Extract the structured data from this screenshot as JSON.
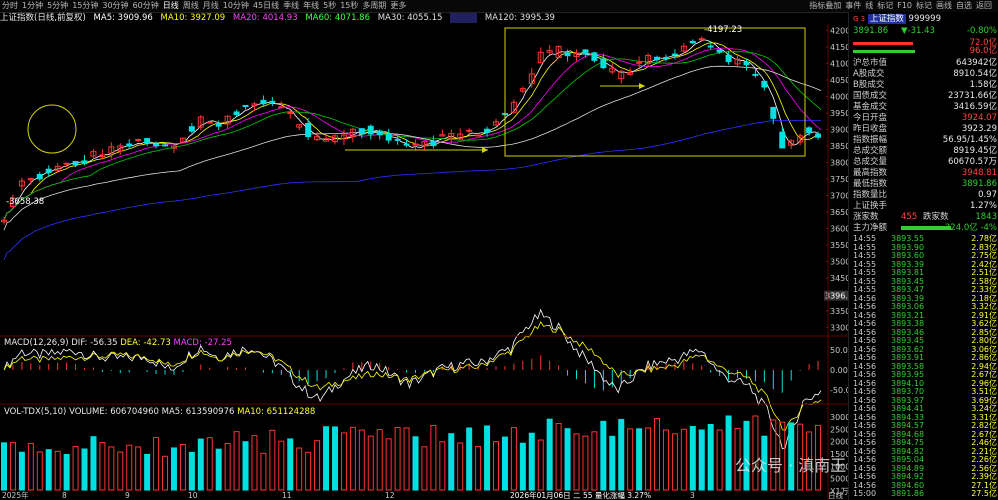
{
  "toolbar": {
    "items": [
      "分时",
      "1分钟",
      "5分钟",
      "15分钟",
      "30分钟",
      "60分钟",
      "日线",
      "周线",
      "月线",
      "10分钟",
      "45日线",
      "季线",
      "年线",
      "5秒",
      "15秒",
      "多周期",
      "更多"
    ],
    "active_index": 6,
    "right_items": [
      "指标叠加",
      "事件",
      "线",
      "标记",
      "F10",
      "标记",
      "画线",
      "自选",
      "返回"
    ]
  },
  "ma_line": {
    "title": "上证指数(日线,前复权)",
    "ma5": "MA5: 3909.96",
    "ma10": "MA10: 3927.09",
    "ma20": "MA20: 4014.93",
    "ma60": "MA60: 4071.86",
    "ma30": "MA30: 4055.15",
    "ma120": "MA120: 3995.39"
  },
  "price_axis": {
    "ticks": [
      "4200",
      "4150",
      "4100",
      "4050",
      "4000",
      "3950",
      "3900",
      "3850",
      "3800",
      "3750",
      "3700",
      "3650",
      "3600",
      "3550",
      "3500",
      "3450",
      "3400",
      "3350",
      "3300"
    ],
    "marker": "3396.3",
    "high_label": "4197.23",
    "low_label": "3658.38"
  },
  "macd": {
    "header": "MACD(12,26,9)",
    "dif": "DIF: -56.35",
    "dea": "DEA: -42.73",
    "macd": "MACD: -27.25",
    "ticks": [
      "50.00",
      "0.00",
      "-50.00"
    ]
  },
  "volume": {
    "header": "VOL-TDX(5,10)",
    "volume": "VOLUME: 606704960",
    "ma5": "MA5: 613590976",
    "ma10": "MA10: 651124288",
    "ticks": [
      "30000",
      "25000",
      "20000",
      "15000",
      "10000",
      "5000",
      "X1万"
    ]
  },
  "x_axis": {
    "labels": [
      "2025年",
      "8",
      "9",
      "10",
      "11",
      "12",
      "2026年01月06日 二 55 量化涨幅 3.27%",
      "2",
      "3",
      "日线"
    ]
  },
  "right_panel": {
    "index_name": "上证指数",
    "index_code": "999999",
    "price": "3891.86",
    "change": "▼-31.43",
    "change_pct": "-0.80%",
    "bar_values": [
      "72.0亿",
      "96.0亿"
    ],
    "stats": [
      {
        "k": "沪总市值",
        "v": "643942亿"
      },
      {
        "k": "A股成交",
        "v": "8910.54亿"
      },
      {
        "k": "B股成交",
        "v": "1.58亿"
      },
      {
        "k": "国债成交",
        "v": "23731.66亿"
      },
      {
        "k": "基金成交",
        "v": "3416.59亿"
      },
      {
        "k": "今日开盘",
        "v": "3924.07"
      },
      {
        "k": "昨日收盘",
        "v": "3923.29"
      },
      {
        "k": "指数振幅",
        "v": "56.95/1.45%"
      },
      {
        "k": "总成交额",
        "v": "8919.45亿"
      },
      {
        "k": "总成交量",
        "v": "60670.57万"
      },
      {
        "k": "最高指数",
        "v": "3948.81"
      },
      {
        "k": "最低指数",
        "v": "3891.86"
      },
      {
        "k": "指数量比",
        "v": "0.97"
      },
      {
        "k": "上证换手",
        "v": "1.27%"
      }
    ],
    "updown": {
      "up_label": "涨家数",
      "up": "455",
      "down_label": "跌家数",
      "down": "1843"
    },
    "main_flow": {
      "label": "主力净额",
      "value": "-324.0亿",
      "pct": "-4%"
    },
    "ticks": [
      {
        "t": "14:55",
        "p": "3893.55",
        "a": "2.78亿"
      },
      {
        "t": "14:55",
        "p": "3893.90",
        "a": "2.83亿"
      },
      {
        "t": "14:55",
        "p": "3893.60",
        "a": "2.75亿"
      },
      {
        "t": "14:55",
        "p": "3893.39",
        "a": "2.42亿"
      },
      {
        "t": "14:55",
        "p": "3893.81",
        "a": "2.51亿"
      },
      {
        "t": "14:55",
        "p": "3893.45",
        "a": "2.58亿"
      },
      {
        "t": "14:55",
        "p": "3893.47",
        "a": "2.33亿"
      },
      {
        "t": "14:56",
        "p": "3893.39",
        "a": "2.18亿"
      },
      {
        "t": "14:56",
        "p": "3893.06",
        "a": "3.32亿"
      },
      {
        "t": "14:56",
        "p": "3893.21",
        "a": "2.91亿"
      },
      {
        "t": "14:56",
        "p": "3893.38",
        "a": "3.62亿"
      },
      {
        "t": "14:56",
        "p": "3893.46",
        "a": "2.85亿"
      },
      {
        "t": "14:56",
        "p": "3893.45",
        "a": "2.80亿"
      },
      {
        "t": "14:56",
        "p": "3893.62",
        "a": "3.06亿"
      },
      {
        "t": "14:56",
        "p": "3893.91",
        "a": "2.86亿"
      },
      {
        "t": "14:56",
        "p": "3893.58",
        "a": "2.94亿"
      },
      {
        "t": "14:56",
        "p": "3893.95",
        "a": "2.67亿"
      },
      {
        "t": "14:56",
        "p": "3894.10",
        "a": "2.96亿"
      },
      {
        "t": "14:56",
        "p": "3893.70",
        "a": "3.51亿"
      },
      {
        "t": "14:56",
        "p": "3893.97",
        "a": "3.69亿"
      },
      {
        "t": "14:56",
        "p": "3894.41",
        "a": "3.24亿"
      },
      {
        "t": "14:56",
        "p": "3894.33",
        "a": "3.31亿"
      },
      {
        "t": "14:56",
        "p": "3894.57",
        "a": "2.82亿"
      },
      {
        "t": "14:56",
        "p": "3894.68",
        "a": "2.67亿"
      },
      {
        "t": "14:56",
        "p": "3894.75",
        "a": "2.46亿"
      },
      {
        "t": "14:56",
        "p": "3894.82",
        "a": "2.21亿"
      },
      {
        "t": "14:56",
        "p": "3895.04",
        "a": "2.26亿"
      },
      {
        "t": "14:56",
        "p": "3894.89",
        "a": "2.56亿"
      },
      {
        "t": "14:56",
        "p": "3894.92",
        "a": "2.39亿"
      },
      {
        "t": "14:56",
        "p": "3894.60",
        "a": "27.1亿"
      },
      {
        "t": "15:00",
        "p": "3891.86",
        "a": "27.5亿"
      }
    ]
  },
  "watermark": "公众号 · 滇南王",
  "colors": {
    "up": "#ff3333",
    "down": "#00e0e0",
    "ma5": "#ffffff",
    "ma10": "#ffff00",
    "ma20": "#ff00ff",
    "ma30": "#00ff00",
    "ma60": "#ffffff",
    "ma120": "#4040ff",
    "annot": "#d4d400"
  }
}
